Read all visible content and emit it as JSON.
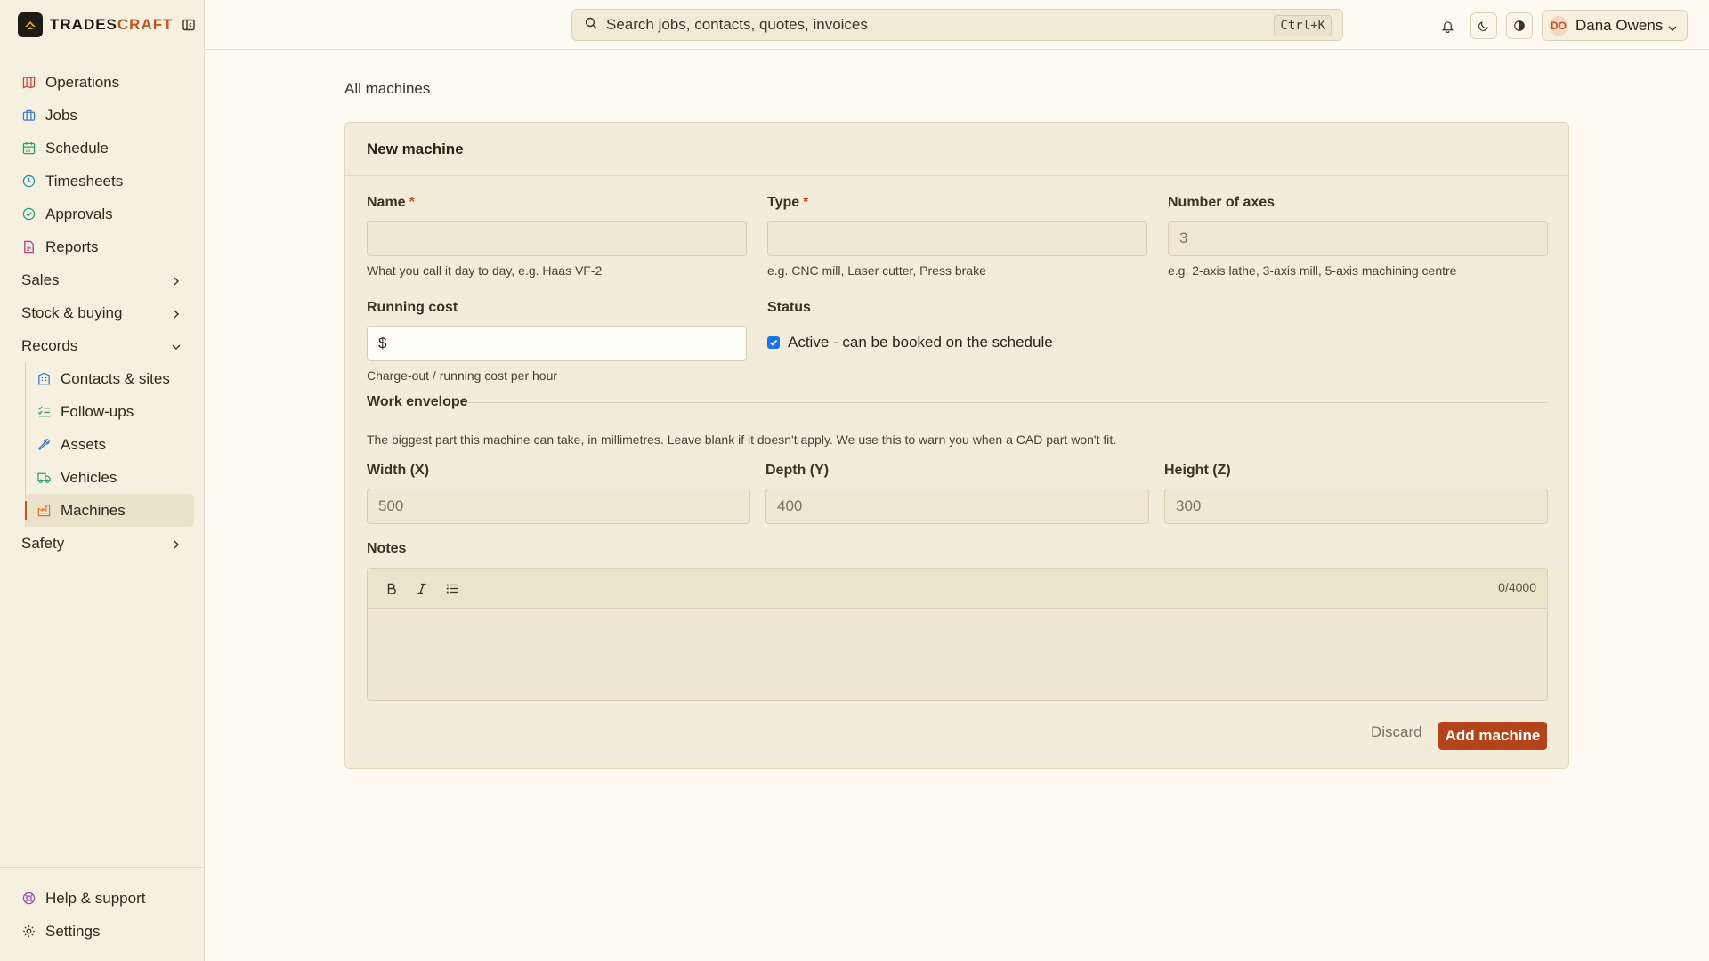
{
  "brand": {
    "name_a": "TRADES",
    "name_b": "CRAFT",
    "accent_color": "#c0561f"
  },
  "sidebar": {
    "items": [
      {
        "label": "Operations",
        "icon": "map-icon"
      },
      {
        "label": "Jobs",
        "icon": "briefcase-icon"
      },
      {
        "label": "Schedule",
        "icon": "calendar-icon"
      },
      {
        "label": "Timesheets",
        "icon": "clock-icon"
      },
      {
        "label": "Approvals",
        "icon": "check-circle-icon"
      },
      {
        "label": "Reports",
        "icon": "document-icon"
      }
    ],
    "groups": [
      {
        "label": "Sales"
      },
      {
        "label": "Stock & buying"
      },
      {
        "label": "Records"
      },
      {
        "label": "Safety"
      }
    ],
    "records_items": [
      {
        "label": "Contacts & sites",
        "icon": "building-icon"
      },
      {
        "label": "Follow-ups",
        "icon": "checklist-icon"
      },
      {
        "label": "Assets",
        "icon": "wrench-icon"
      },
      {
        "label": "Vehicles",
        "icon": "truck-icon"
      },
      {
        "label": "Machines",
        "icon": "factory-icon"
      }
    ],
    "bottom": [
      {
        "label": "Help & support",
        "icon": "lifebuoy-icon"
      },
      {
        "label": "Settings",
        "icon": "gear-icon"
      }
    ]
  },
  "topbar": {
    "search_placeholder": "Search jobs, contacts, quotes, invoices",
    "shortcut": "Ctrl+K",
    "user": {
      "initials": "DO",
      "name": "Dana Owens"
    }
  },
  "breadcrumb": "All machines",
  "form": {
    "title": "New machine",
    "name": {
      "label": "Name",
      "required": "*",
      "value": "",
      "hint": "What you call it day to day, e.g. Haas VF-2"
    },
    "type": {
      "label": "Type",
      "required": "*",
      "value": "",
      "hint": "e.g. CNC mill, Laser cutter, Press brake"
    },
    "axes": {
      "label": "Number of axes",
      "placeholder": "3",
      "hint": "e.g. 2-axis lathe, 3-axis mill, 5-axis machining centre"
    },
    "running_cost": {
      "label": "Running cost",
      "prefix": "$",
      "value": "",
      "hint": "Charge-out / running cost per hour"
    },
    "status": {
      "label": "Status",
      "checkbox_label": "Active - can be booked on the schedule",
      "checked": true
    },
    "envelope": {
      "title": "Work envelope",
      "description": "The biggest part this machine can take, in millimetres. Leave blank if it doesn't apply. We use this to warn you when a CAD part won't fit.",
      "width": {
        "label": "Width (X)",
        "placeholder": "500"
      },
      "depth": {
        "label": "Depth (Y)",
        "placeholder": "400"
      },
      "height": {
        "label": "Height (Z)",
        "placeholder": "300"
      }
    },
    "notes": {
      "label": "Notes",
      "counter": "0/4000",
      "value": ""
    },
    "discard_label": "Discard",
    "submit_label": "Add machine"
  }
}
